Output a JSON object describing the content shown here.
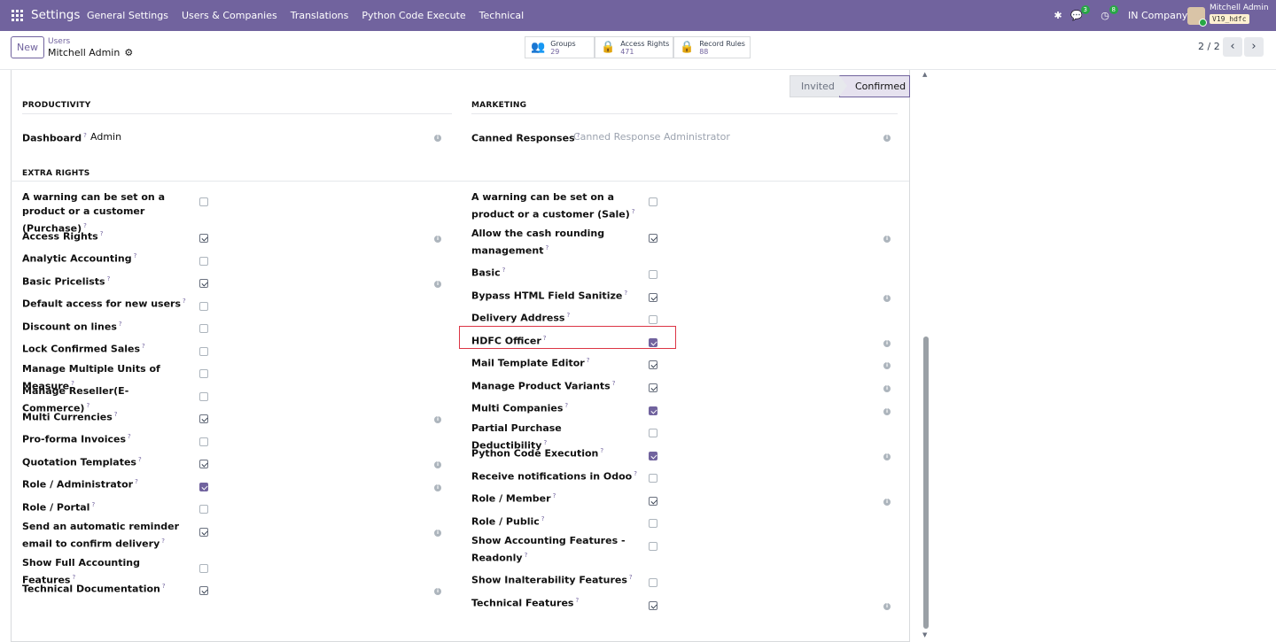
{
  "topbar": {
    "brand": "Settings",
    "menu": [
      "General Settings",
      "Users & Companies",
      "Translations",
      "Python Code Execute",
      "Technical"
    ],
    "chat_count": "3",
    "activity_count": "8",
    "company": "IN Company",
    "user_name": "Mitchell Admin",
    "database": "V19_hdfc"
  },
  "controlpanel": {
    "new_label": "New",
    "breadcrumb_parent": "Users",
    "breadcrumb_current": "Mitchell Admin",
    "stats": [
      {
        "label": "Groups",
        "value": "29"
      },
      {
        "label": "Access Rights",
        "value": "471"
      },
      {
        "label": "Record Rules",
        "value": "88"
      }
    ],
    "pager": "2 / 2"
  },
  "statusbar": {
    "invited": "Invited",
    "confirmed": "Confirmed"
  },
  "productivity": {
    "title": "PRODUCTIVITY",
    "dashboard_label": "Dashboard",
    "dashboard_value": "Admin"
  },
  "marketing": {
    "title": "MARKETING",
    "canned_label": "Canned Responses",
    "canned_placeholder": "Canned Response Administrator"
  },
  "extra_rights": {
    "title": "EXTRA RIGHTS",
    "left": [
      {
        "label": "A warning can be set on a product or a customer (Purchase)",
        "checked": false
      },
      {
        "label": "Access Rights",
        "checked": true
      },
      {
        "label": "Analytic Accounting",
        "checked": false
      },
      {
        "label": "Basic Pricelists",
        "checked": true
      },
      {
        "label": "Default access for new users",
        "checked": false
      },
      {
        "label": "Discount on lines",
        "checked": false
      },
      {
        "label": "Lock Confirmed Sales",
        "checked": false
      },
      {
        "label": "Manage Multiple Units of Measure",
        "checked": false
      },
      {
        "label": "Manage Reseller(E-Commerce)",
        "checked": false
      },
      {
        "label": "Multi Currencies",
        "checked": true
      },
      {
        "label": "Pro-forma Invoices",
        "checked": false
      },
      {
        "label": "Quotation Templates",
        "checked": true
      },
      {
        "label": "Role / Administrator",
        "checked": true
      },
      {
        "label": "Role / Portal",
        "checked": false
      },
      {
        "label": "Send an automatic reminder email to confirm delivery",
        "checked": true
      },
      {
        "label": "Show Full Accounting Features",
        "checked": false
      },
      {
        "label": "Technical Documentation",
        "checked": true
      }
    ],
    "right": [
      {
        "label": "A warning can be set on a product or a customer (Sale)",
        "checked": false
      },
      {
        "label": "Allow the cash rounding management",
        "checked": true
      },
      {
        "label": "Basic",
        "checked": false
      },
      {
        "label": "Bypass HTML Field Sanitize",
        "checked": true
      },
      {
        "label": "Delivery Address",
        "checked": false
      },
      {
        "label": "HDFC Officer",
        "checked": true
      },
      {
        "label": "Mail Template Editor",
        "checked": true
      },
      {
        "label": "Manage Product Variants",
        "checked": true
      },
      {
        "label": "Multi Companies",
        "checked": true
      },
      {
        "label": "Partial Purchase Deductibility",
        "checked": false
      },
      {
        "label": "Python Code Execution",
        "checked": true
      },
      {
        "label": "Receive notifications in Odoo",
        "checked": false
      },
      {
        "label": "Role / Member",
        "checked": true
      },
      {
        "label": "Role / Public",
        "checked": false
      },
      {
        "label": "Show Accounting Features - Readonly",
        "checked": false
      },
      {
        "label": "Show Inalterability Features",
        "checked": false
      },
      {
        "label": "Technical Features",
        "checked": true
      }
    ]
  }
}
